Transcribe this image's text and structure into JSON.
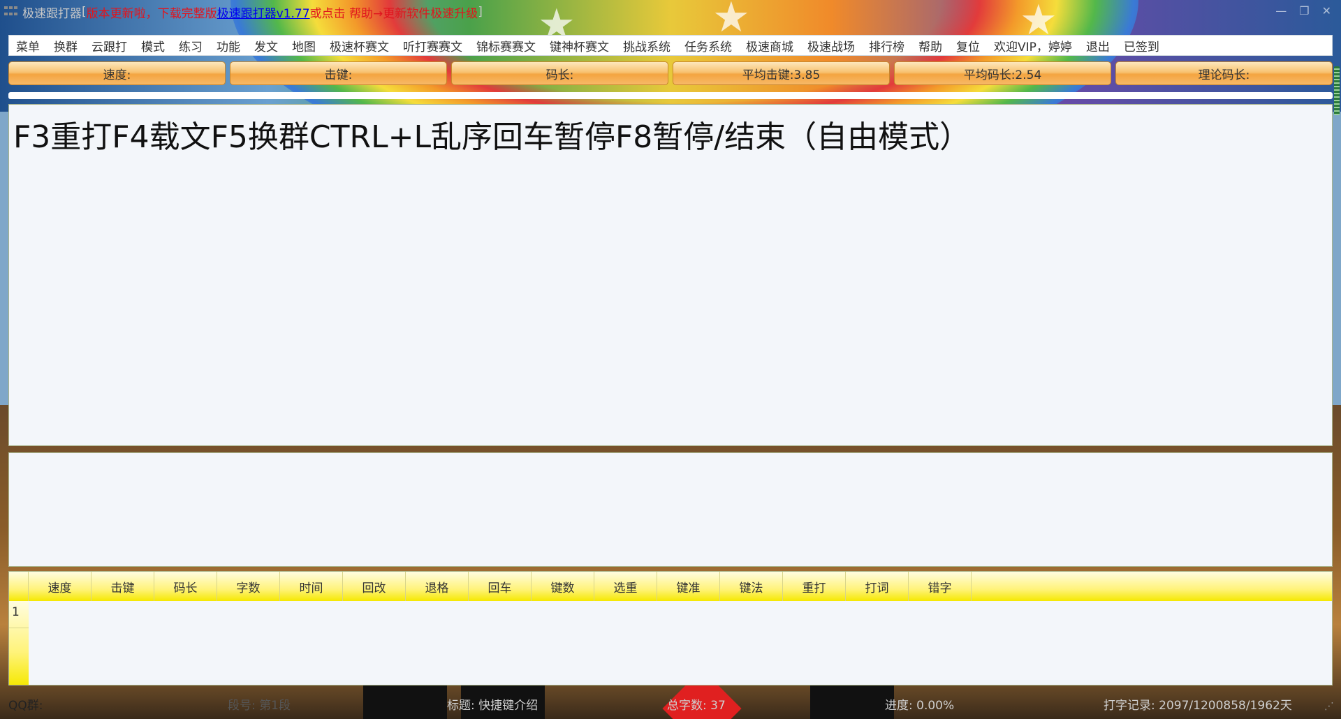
{
  "titlebar": {
    "app_name": "极速跟打器",
    "bracket_open": "[",
    "notice": "版本更新啦，下载完整版",
    "link_text": "极速跟打器v1.77",
    "notice2": " 或点击 帮助→更新软件极速升级",
    "bracket_close": "]",
    "min_glyph": "—",
    "restore_glyph": "❐",
    "close_glyph": "✕"
  },
  "menu": {
    "items": [
      "菜单",
      "换群",
      "云跟打",
      "模式",
      "练习",
      "功能",
      "发文",
      "地图",
      "极速杯赛文",
      "听打赛赛文",
      "锦标赛赛文",
      "键神杯赛文",
      "挑战系统",
      "任务系统",
      "极速商城",
      "极速战场",
      "排行榜",
      "帮助",
      "复位",
      "欢迎VIP，婷婷",
      "退出",
      "已签到"
    ]
  },
  "stats": {
    "speed": "速度:",
    "keystroke": "击键:",
    "code_length": "码长:",
    "avg_keystroke": "平均击键:3.85",
    "avg_code_length": "平均码长:2.54",
    "theory_code_length": "理论码长:"
  },
  "text_area": {
    "content": "F3重打F4载文F5换群CTRL+L乱序回车暂停F8暂停/结束（自由模式）"
  },
  "results": {
    "columns": [
      "速度",
      "击键",
      "码长",
      "字数",
      "时间",
      "回改",
      "退格",
      "回车",
      "键数",
      "选重",
      "键准",
      "键法",
      "重打",
      "打词",
      "错字"
    ],
    "row_numbers": [
      "1"
    ]
  },
  "status": {
    "qq_group": "QQ群:",
    "segment": "段号: 第1段",
    "title": "标题: 快捷键介绍",
    "total_chars": "总字数: 37",
    "progress": "进度: 0.00%",
    "record": "打字记录: 2097/1200858/1962天"
  },
  "colors": {
    "accent_orange": "#f4a440",
    "header_yellow": "#f5e800",
    "notice_red": "#e0151e",
    "link_blue": "#0000ee",
    "panel_bg": "#f3f6fa"
  }
}
